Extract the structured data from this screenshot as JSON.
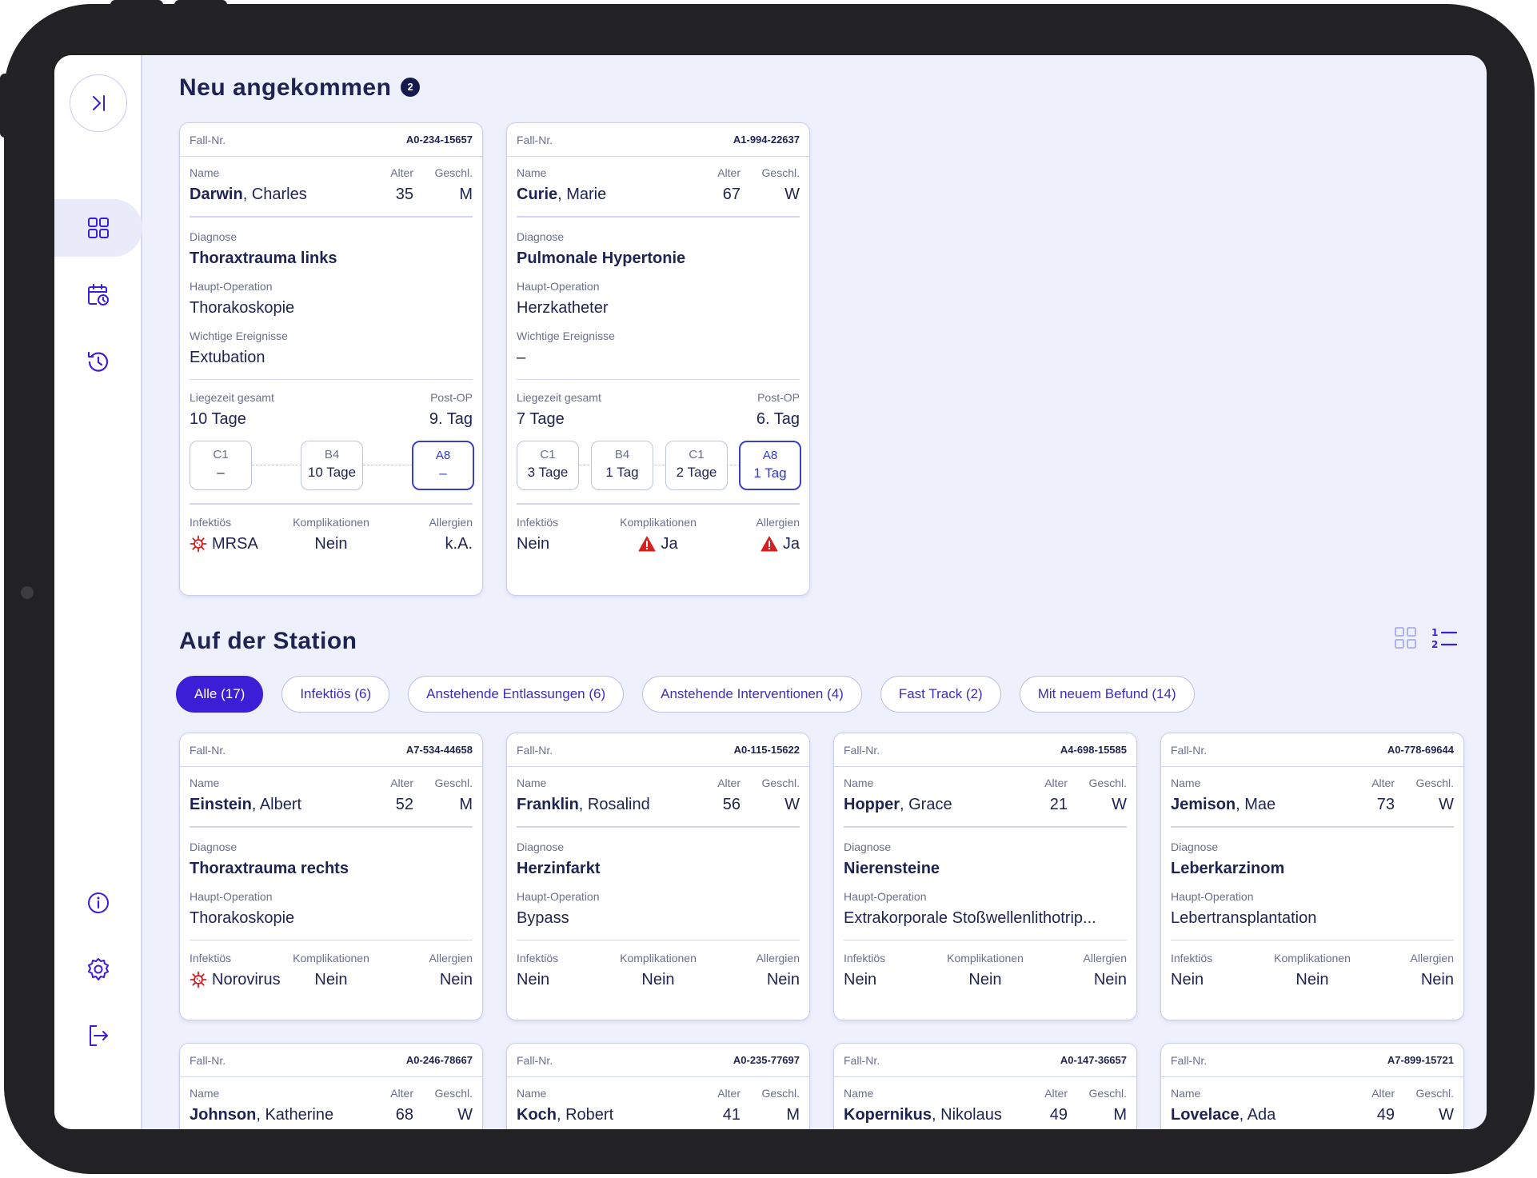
{
  "sidebar": {
    "items": [
      {
        "name": "dashboard"
      },
      {
        "name": "calendar"
      },
      {
        "name": "history"
      },
      {
        "name": "info"
      },
      {
        "name": "settings"
      },
      {
        "name": "logout"
      }
    ]
  },
  "new_section": {
    "title": "Neu angekommen",
    "count": "2"
  },
  "labels": {
    "case_no": "Fall-Nr.",
    "name": "Name",
    "age": "Alter",
    "sex": "Geschl.",
    "diagnosis": "Diagnose",
    "operation": "Haupt-Operation",
    "events": "Wichtige Ereignisse",
    "stay_total": "Liegezeit gesamt",
    "post_op": "Post-OP",
    "infectious": "Infektiös",
    "complications": "Komplikationen",
    "allergies": "Allergien"
  },
  "new_cases": [
    {
      "case_no": "A0-234-15657",
      "last": "Darwin",
      "first": ", Charles",
      "age": "35",
      "sex": "M",
      "diagnosis": "Thoraxtrauma links",
      "operation": "Thorakoskopie",
      "events": "Extubation",
      "stay": "10 Tage",
      "postop": "9. Tag",
      "stations": [
        {
          "code": "C1",
          "dur": "–"
        },
        {
          "code": "B4",
          "dur": "10 Tage"
        },
        {
          "code": "A8",
          "dur": "–"
        }
      ],
      "infectious": "MRSA",
      "complications": "Nein",
      "allergies": "k.A."
    },
    {
      "case_no": "A1-994-22637",
      "last": "Curie",
      "first": ", Marie",
      "age": "67",
      "sex": "W",
      "diagnosis": "Pulmonale Hypertonie",
      "operation": "Herzkatheter",
      "events": "–",
      "stay": "7 Tage",
      "postop": "6. Tag",
      "stations": [
        {
          "code": "C1",
          "dur": "3 Tage"
        },
        {
          "code": "B4",
          "dur": "1 Tag"
        },
        {
          "code": "C1",
          "dur": "2 Tage"
        },
        {
          "code": "A8",
          "dur": "1 Tag"
        }
      ],
      "infectious": "Nein",
      "complications": "Ja",
      "allergies": "Ja"
    }
  ],
  "station_section": {
    "title": "Auf der Station",
    "filters": [
      "Alle (17)",
      "Infektiös (6)",
      "Anstehende Entlassungen (6)",
      "Anstehende Interventionen (4)",
      "Fast Track (2)",
      "Mit neuem Befund (14)"
    ]
  },
  "station_cases": [
    {
      "case_no": "A7-534-44658",
      "last": "Einstein",
      "first": ", Albert",
      "age": "52",
      "sex": "M",
      "diagnosis": "Thoraxtrauma rechts",
      "operation": "Thorakoskopie",
      "infectious": "Norovirus",
      "complications": "Nein",
      "allergies": "Nein"
    },
    {
      "case_no": "A0-115-15622",
      "last": "Franklin",
      "first": ", Rosalind",
      "age": "56",
      "sex": "W",
      "diagnosis": "Herzinfarkt",
      "operation": "Bypass",
      "infectious": "Nein",
      "complications": "Nein",
      "allergies": "Nein"
    },
    {
      "case_no": "A4-698-15585",
      "last": "Hopper",
      "first": ", Grace",
      "age": "21",
      "sex": "W",
      "diagnosis": "Nierensteine",
      "operation": "Extrakorporale Stoßwellenlithotrip...",
      "infectious": "Nein",
      "complications": "Nein",
      "allergies": "Nein"
    },
    {
      "case_no": "A0-778-69644",
      "last": "Jemison",
      "first": ", Mae",
      "age": "73",
      "sex": "W",
      "diagnosis": "Leberkarzinom",
      "operation": "Lebertransplantation",
      "infectious": "Nein",
      "complications": "Nein",
      "allergies": "Nein"
    },
    {
      "case_no": "A0-246-78667",
      "last": "Johnson",
      "first": ", Katherine",
      "age": "68",
      "sex": "W"
    },
    {
      "case_no": "A0-235-77697",
      "last": "Koch",
      "first": ", Robert",
      "age": "41",
      "sex": "M"
    },
    {
      "case_no": "A0-147-36657",
      "last": "Kopernikus",
      "first": ", Nikolaus",
      "age": "49",
      "sex": "M"
    },
    {
      "case_no": "A7-899-15721",
      "last": "Lovelace",
      "first": ", Ada",
      "age": "49",
      "sex": "W"
    }
  ],
  "colors": {
    "accent": "#3b1ed6",
    "navy": "#1e2451",
    "warning": "#d42020",
    "background": "#eef0fc"
  }
}
